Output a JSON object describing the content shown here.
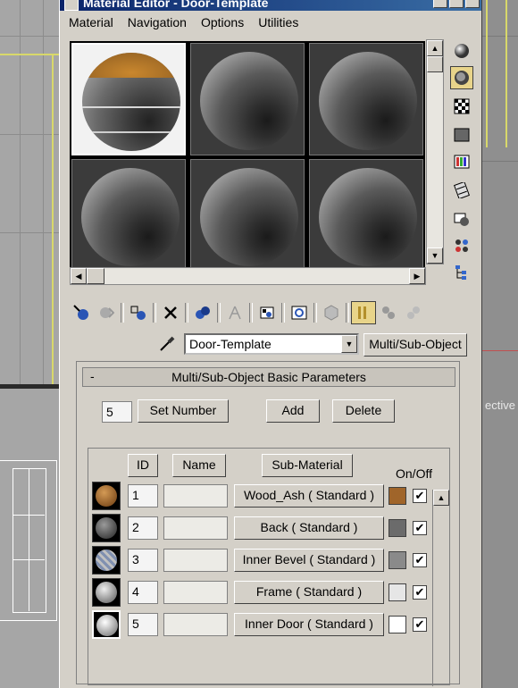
{
  "window": {
    "title": "Material Editor - Door-Template"
  },
  "menu": [
    "Material",
    "Navigation",
    "Options",
    "Utilities"
  ],
  "viewport": {
    "label": "ective"
  },
  "material_name": "Door-Template",
  "material_type_button": "Multi/Sub-Object",
  "rollout": {
    "title": "Multi/Sub-Object Basic Parameters",
    "collapse": "-",
    "count": "5",
    "set_number": "Set Number",
    "add": "Add",
    "delete": "Delete",
    "headers": {
      "id": "ID",
      "name": "Name",
      "sub_material": "Sub-Material",
      "on_off": "On/Off"
    }
  },
  "sub_materials": [
    {
      "id": "1",
      "name": "",
      "material": "Wood_Ash  ( Standard )",
      "color": "#a0652a",
      "on": "✔"
    },
    {
      "id": "2",
      "name": "",
      "material": "Back  ( Standard )",
      "color": "#6b6b6b",
      "on": "✔"
    },
    {
      "id": "3",
      "name": "",
      "material": "Inner Bevel  ( Standard )",
      "color": "#8a8a8a",
      "on": "✔"
    },
    {
      "id": "4",
      "name": "",
      "material": "Frame  ( Standard )",
      "color": "#e6e6e6",
      "on": "✔"
    },
    {
      "id": "5",
      "name": "",
      "material": "Inner Door  ( Standard )",
      "color": "#ffffff",
      "on": "✔"
    }
  ],
  "colors": {
    "title_start": "#0a246a",
    "title_end": "#3a6ea5",
    "panel": "#d4d0c8",
    "active_tool": "#e8d48a"
  },
  "icons": {
    "side": [
      "sample-type-icon",
      "backlight-icon",
      "background-icon",
      "uv-tiling-icon",
      "video-color-check-icon",
      "make-preview-icon",
      "options-icon",
      "select-by-material-icon",
      "material-map-navigator-icon"
    ],
    "toolbar": [
      "get-material-icon",
      "put-to-scene-icon",
      "assign-to-selection-icon",
      "reset-map-icon",
      "make-copy-icon",
      "make-unique-icon",
      "put-to-library-icon",
      "material-effects-channel-icon",
      "show-map-in-viewport-icon",
      "show-end-result-icon",
      "go-to-parent-icon",
      "go-forward-to-sibling-icon"
    ]
  }
}
